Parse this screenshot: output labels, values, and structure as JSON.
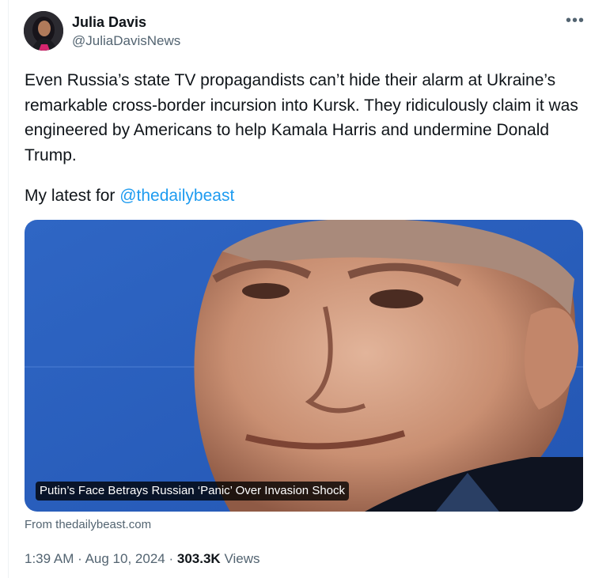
{
  "author": {
    "name": "Julia Davis",
    "handle": "@JuliaDavisNews"
  },
  "tweet": {
    "text": "Even Russia’s state TV propagandists can’t hide their alarm at Ukraine’s remarkable cross-border incursion into Kursk. They ridiculously claim it was engineered by Americans to help Kamala Harris and undermine Donald Trump.",
    "byline_prefix": "My latest for ",
    "mention": "@thedailybeast"
  },
  "card": {
    "title": "Putin’s Face Betrays Russian ‘Panic’ Over Invasion Shock",
    "source": "From thedailybeast.com",
    "background_color": "#2a5fbd"
  },
  "meta": {
    "time": "1:39 AM",
    "separator": "·",
    "date": "Aug 10, 2024",
    "views_count": "303.3K",
    "views_label": "Views"
  },
  "icons": {
    "more": "more-horizontal-icon"
  },
  "colors": {
    "link": "#1d9bf0",
    "secondary_text": "#536471",
    "primary_text": "#0f1419"
  }
}
